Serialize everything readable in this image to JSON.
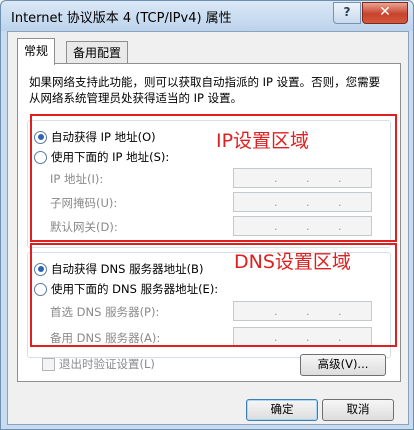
{
  "window": {
    "title": "Internet 协议版本 4 (TCP/IPv4) 属性",
    "help_glyph": "?",
    "close_glyph": "✕"
  },
  "tabs": [
    {
      "label": "常规"
    },
    {
      "label": "备用配置"
    }
  ],
  "description": "如果网络支持此功能，则可以获取自动指派的 IP 设置。否则，您需要从网络系统管理员处获得适当的 IP 设置。",
  "ip": {
    "auto_label": "自动获得 IP 地址(O)",
    "manual_label": "使用下面的 IP 地址(S):",
    "selected": "auto",
    "fields": [
      {
        "label": "IP 地址(I):",
        "value": ""
      },
      {
        "label": "子网掩码(U):",
        "value": ""
      },
      {
        "label": "默认网关(D):",
        "value": ""
      }
    ],
    "annotation": "IP设置区域"
  },
  "dns": {
    "auto_label": "自动获得 DNS 服务器地址(B)",
    "manual_label": "使用下面的 DNS 服务器地址(E):",
    "selected": "auto",
    "fields": [
      {
        "label": "首选 DNS 服务器(P):",
        "value": ""
      },
      {
        "label": "备用 DNS 服务器(A):",
        "value": ""
      }
    ],
    "annotation": "DNS设置区域"
  },
  "validate_checkbox": {
    "label": "退出时验证设置(L)",
    "checked": false
  },
  "buttons": {
    "advanced": "高级(V)...",
    "ok": "确定",
    "cancel": "取消"
  },
  "colors": {
    "annotation": "#e02020",
    "title_bar": "#bcd3ec"
  }
}
